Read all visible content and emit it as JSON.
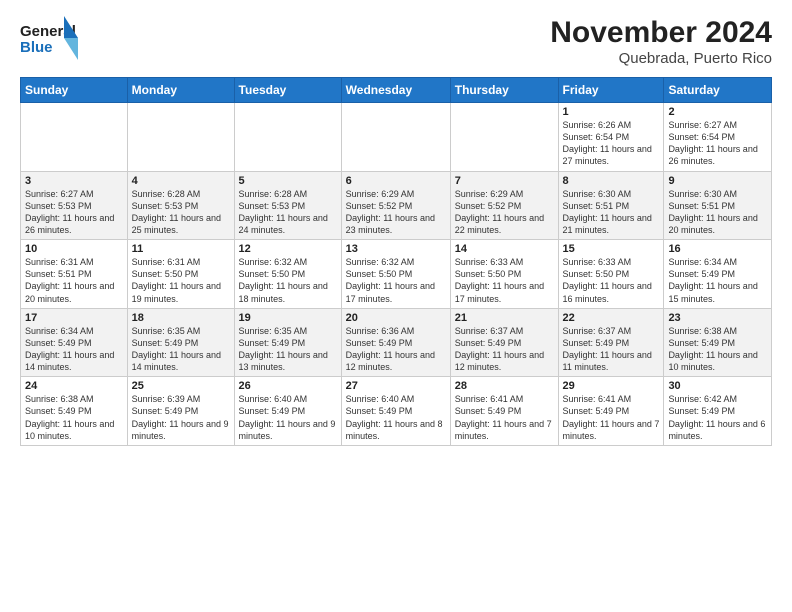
{
  "logo": {
    "line1": "General",
    "line2": "Blue"
  },
  "title": "November 2024",
  "subtitle": "Quebrada, Puerto Rico",
  "days_of_week": [
    "Sunday",
    "Monday",
    "Tuesday",
    "Wednesday",
    "Thursday",
    "Friday",
    "Saturday"
  ],
  "weeks": [
    [
      {
        "day": "",
        "info": ""
      },
      {
        "day": "",
        "info": ""
      },
      {
        "day": "",
        "info": ""
      },
      {
        "day": "",
        "info": ""
      },
      {
        "day": "",
        "info": ""
      },
      {
        "day": "1",
        "info": "Sunrise: 6:26 AM\nSunset: 6:54 PM\nDaylight: 11 hours and 27 minutes."
      },
      {
        "day": "2",
        "info": "Sunrise: 6:27 AM\nSunset: 6:54 PM\nDaylight: 11 hours and 26 minutes."
      }
    ],
    [
      {
        "day": "3",
        "info": "Sunrise: 6:27 AM\nSunset: 5:53 PM\nDaylight: 11 hours and 26 minutes."
      },
      {
        "day": "4",
        "info": "Sunrise: 6:28 AM\nSunset: 5:53 PM\nDaylight: 11 hours and 25 minutes."
      },
      {
        "day": "5",
        "info": "Sunrise: 6:28 AM\nSunset: 5:53 PM\nDaylight: 11 hours and 24 minutes."
      },
      {
        "day": "6",
        "info": "Sunrise: 6:29 AM\nSunset: 5:52 PM\nDaylight: 11 hours and 23 minutes."
      },
      {
        "day": "7",
        "info": "Sunrise: 6:29 AM\nSunset: 5:52 PM\nDaylight: 11 hours and 22 minutes."
      },
      {
        "day": "8",
        "info": "Sunrise: 6:30 AM\nSunset: 5:51 PM\nDaylight: 11 hours and 21 minutes."
      },
      {
        "day": "9",
        "info": "Sunrise: 6:30 AM\nSunset: 5:51 PM\nDaylight: 11 hours and 20 minutes."
      }
    ],
    [
      {
        "day": "10",
        "info": "Sunrise: 6:31 AM\nSunset: 5:51 PM\nDaylight: 11 hours and 20 minutes."
      },
      {
        "day": "11",
        "info": "Sunrise: 6:31 AM\nSunset: 5:50 PM\nDaylight: 11 hours and 19 minutes."
      },
      {
        "day": "12",
        "info": "Sunrise: 6:32 AM\nSunset: 5:50 PM\nDaylight: 11 hours and 18 minutes."
      },
      {
        "day": "13",
        "info": "Sunrise: 6:32 AM\nSunset: 5:50 PM\nDaylight: 11 hours and 17 minutes."
      },
      {
        "day": "14",
        "info": "Sunrise: 6:33 AM\nSunset: 5:50 PM\nDaylight: 11 hours and 17 minutes."
      },
      {
        "day": "15",
        "info": "Sunrise: 6:33 AM\nSunset: 5:50 PM\nDaylight: 11 hours and 16 minutes."
      },
      {
        "day": "16",
        "info": "Sunrise: 6:34 AM\nSunset: 5:49 PM\nDaylight: 11 hours and 15 minutes."
      }
    ],
    [
      {
        "day": "17",
        "info": "Sunrise: 6:34 AM\nSunset: 5:49 PM\nDaylight: 11 hours and 14 minutes."
      },
      {
        "day": "18",
        "info": "Sunrise: 6:35 AM\nSunset: 5:49 PM\nDaylight: 11 hours and 14 minutes."
      },
      {
        "day": "19",
        "info": "Sunrise: 6:35 AM\nSunset: 5:49 PM\nDaylight: 11 hours and 13 minutes."
      },
      {
        "day": "20",
        "info": "Sunrise: 6:36 AM\nSunset: 5:49 PM\nDaylight: 11 hours and 12 minutes."
      },
      {
        "day": "21",
        "info": "Sunrise: 6:37 AM\nSunset: 5:49 PM\nDaylight: 11 hours and 12 minutes."
      },
      {
        "day": "22",
        "info": "Sunrise: 6:37 AM\nSunset: 5:49 PM\nDaylight: 11 hours and 11 minutes."
      },
      {
        "day": "23",
        "info": "Sunrise: 6:38 AM\nSunset: 5:49 PM\nDaylight: 11 hours and 10 minutes."
      }
    ],
    [
      {
        "day": "24",
        "info": "Sunrise: 6:38 AM\nSunset: 5:49 PM\nDaylight: 11 hours and 10 minutes."
      },
      {
        "day": "25",
        "info": "Sunrise: 6:39 AM\nSunset: 5:49 PM\nDaylight: 11 hours and 9 minutes."
      },
      {
        "day": "26",
        "info": "Sunrise: 6:40 AM\nSunset: 5:49 PM\nDaylight: 11 hours and 9 minutes."
      },
      {
        "day": "27",
        "info": "Sunrise: 6:40 AM\nSunset: 5:49 PM\nDaylight: 11 hours and 8 minutes."
      },
      {
        "day": "28",
        "info": "Sunrise: 6:41 AM\nSunset: 5:49 PM\nDaylight: 11 hours and 7 minutes."
      },
      {
        "day": "29",
        "info": "Sunrise: 6:41 AM\nSunset: 5:49 PM\nDaylight: 11 hours and 7 minutes."
      },
      {
        "day": "30",
        "info": "Sunrise: 6:42 AM\nSunset: 5:49 PM\nDaylight: 11 hours and 6 minutes."
      }
    ]
  ]
}
